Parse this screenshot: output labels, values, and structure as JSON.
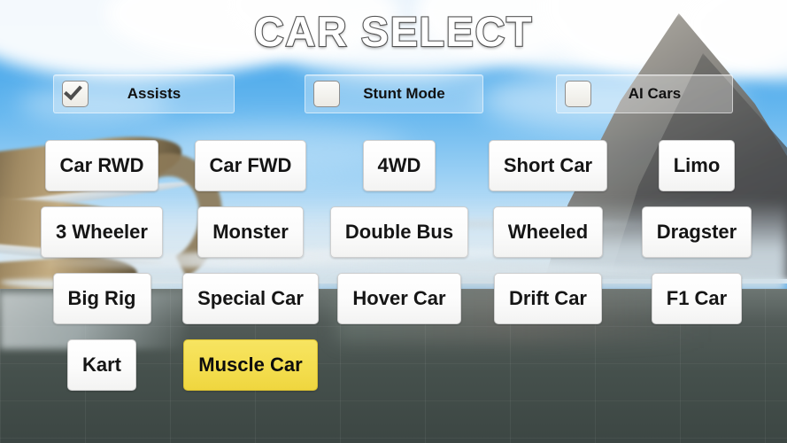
{
  "title": "CAR SELECT",
  "toggles": [
    {
      "label": "Assists",
      "checked": true,
      "name": "assists"
    },
    {
      "label": "Stunt Mode",
      "checked": false,
      "name": "stunt-mode"
    },
    {
      "label": "AI Cars",
      "checked": false,
      "name": "ai-cars"
    }
  ],
  "car_rows": [
    [
      {
        "label": "Car RWD",
        "selected": false
      },
      {
        "label": "Car FWD",
        "selected": false
      },
      {
        "label": "4WD",
        "selected": false
      },
      {
        "label": "Short Car",
        "selected": false
      },
      {
        "label": "Limo",
        "selected": false
      }
    ],
    [
      {
        "label": "3 Wheeler",
        "selected": false
      },
      {
        "label": "Monster",
        "selected": false
      },
      {
        "label": "Double Bus",
        "selected": false
      },
      {
        "label": "Wheeled",
        "selected": false
      },
      {
        "label": "Dragster",
        "selected": false
      }
    ],
    [
      {
        "label": "Big Rig",
        "selected": false
      },
      {
        "label": "Special Car",
        "selected": false
      },
      {
        "label": "Hover Car",
        "selected": false
      },
      {
        "label": "Drift Car",
        "selected": false
      },
      {
        "label": "F1 Car",
        "selected": false
      }
    ],
    [
      {
        "label": "Kart",
        "selected": false
      },
      {
        "label": "Muscle Car",
        "selected": true
      }
    ]
  ],
  "colors": {
    "selected_button": "#f4de4f",
    "button_face": "#ffffff",
    "button_text": "#151515",
    "title_fill": "#ffffff",
    "title_stroke": "#5a5a5a",
    "sky": "#3fa0e8",
    "ground": "#45504c"
  },
  "icons": {
    "check": "check-icon"
  }
}
